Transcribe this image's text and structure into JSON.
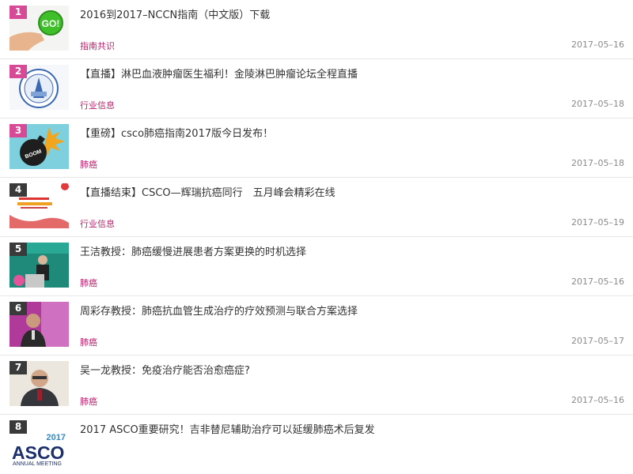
{
  "articles": [
    {
      "rank": "1",
      "rank_color": "#d64a96",
      "title": "2016到2017–NCCN指南（中文版）下载",
      "tag": "指南共识",
      "date": "2017–05–16",
      "thumb_icon": "go-button-hand-image",
      "thumb_text": "GO!"
    },
    {
      "rank": "2",
      "rank_color": "#d64a96",
      "title": "【直播】淋巴血液肿瘤医生福利！金陵淋巴肿瘤论坛全程直播",
      "tag": "行业信息",
      "date": "2017–05–18",
      "thumb_icon": "conference-emblem-image",
      "thumb_text": ""
    },
    {
      "rank": "3",
      "rank_color": "#d64a96",
      "title": "【重磅】csco肺癌指南2017版今日发布！",
      "tag": "肺癌",
      "date": "2017–05–18",
      "thumb_icon": "bomb-image",
      "thumb_text": "BOOM"
    },
    {
      "rank": "4",
      "rank_color": "#3a3a3a",
      "title": "【直播结束】CSCO—辉瑞抗癌同行　五月峰会精彩在线",
      "tag": "行业信息",
      "date": "2017–05–19",
      "thumb_icon": "event-banner-image",
      "thumb_text": ""
    },
    {
      "rank": "5",
      "rank_color": "#3a3a3a",
      "title": "王洁教授：肺癌缓慢进展患者方案更换的时机选择",
      "tag": "肺癌",
      "date": "2017–05–16",
      "thumb_icon": "speaker-podium-photo",
      "thumb_text": ""
    },
    {
      "rank": "6",
      "rank_color": "#3a3a3a",
      "title": "周彩存教授：肺癌抗血管生成治疗的疗效预测与联合方案选择",
      "tag": "肺癌",
      "date": "2017–05–17",
      "thumb_icon": "speaker-portrait-photo",
      "thumb_text": ""
    },
    {
      "rank": "7",
      "rank_color": "#3a3a3a",
      "title": "吴一龙教授：免疫治疗能否治愈癌症?",
      "tag": "肺癌",
      "date": "2017–05–16",
      "thumb_icon": "professor-portrait-photo",
      "thumb_text": ""
    },
    {
      "rank": "8",
      "rank_color": "#3a3a3a",
      "title": "2017 ASCO重要研究！吉非替尼辅助治疗可以延缓肺癌术后复发",
      "tag": "",
      "date": "",
      "thumb_icon": "asco-logo-image",
      "thumb_text": "ASCO",
      "thumb_year": "2017",
      "thumb_sub": "ANNUAL MEETING"
    }
  ]
}
